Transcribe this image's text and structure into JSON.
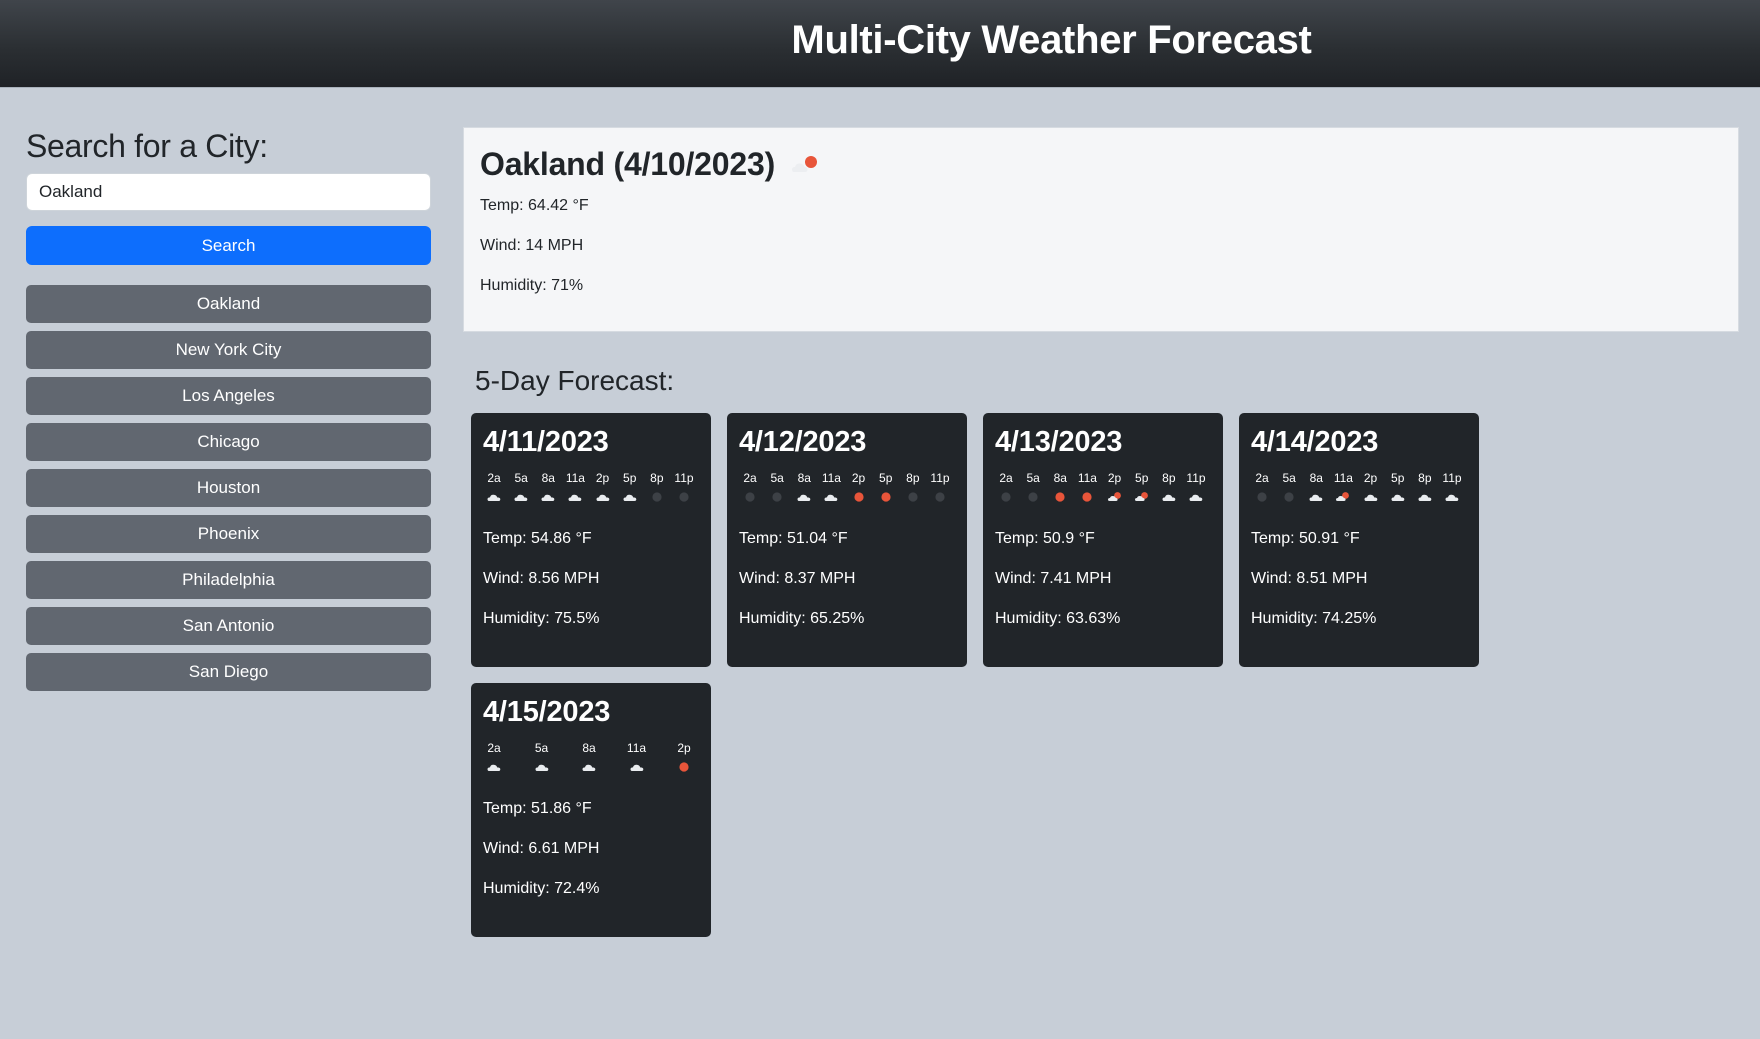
{
  "header": {
    "title": "Multi-City Weather Forecast"
  },
  "search": {
    "heading": "Search for a City:",
    "input_value": "Oakland",
    "button_label": "Search"
  },
  "history": [
    "Oakland",
    "New York City",
    "Los Angeles",
    "Chicago",
    "Houston",
    "Phoenix",
    "Philadelphia",
    "San Antonio",
    "San Diego"
  ],
  "current": {
    "title": "Oakland (4/10/2023)",
    "icon": "few-clouds-night-icon",
    "temp": "Temp: 64.42 °F",
    "wind": "Wind: 14 MPH",
    "humidity": "Humidity: 71%"
  },
  "forecast": {
    "heading": "5-Day Forecast:",
    "days": [
      {
        "date": "4/11/2023",
        "hours": [
          {
            "label": "2a",
            "icon": "cloud-icon"
          },
          {
            "label": "5a",
            "icon": "cloud-icon"
          },
          {
            "label": "8a",
            "icon": "cloud-icon"
          },
          {
            "label": "11a",
            "icon": "cloud-icon"
          },
          {
            "label": "2p",
            "icon": "cloud-icon"
          },
          {
            "label": "5p",
            "icon": "cloud-icon"
          },
          {
            "label": "8p",
            "icon": "clear-night-icon"
          },
          {
            "label": "11p",
            "icon": "clear-night-icon"
          }
        ],
        "temp": "Temp: 54.86 °F",
        "wind": "Wind: 8.56 MPH",
        "humidity": "Humidity: 75.5%"
      },
      {
        "date": "4/12/2023",
        "hours": [
          {
            "label": "2a",
            "icon": "clear-night-icon"
          },
          {
            "label": "5a",
            "icon": "clear-night-icon"
          },
          {
            "label": "8a",
            "icon": "cloud-icon"
          },
          {
            "label": "11a",
            "icon": "cloud-icon"
          },
          {
            "label": "2p",
            "icon": "sun-icon"
          },
          {
            "label": "5p",
            "icon": "sun-icon"
          },
          {
            "label": "8p",
            "icon": "clear-night-icon"
          },
          {
            "label": "11p",
            "icon": "clear-night-icon"
          }
        ],
        "temp": "Temp: 51.04 °F",
        "wind": "Wind: 8.37 MPH",
        "humidity": "Humidity: 65.25%"
      },
      {
        "date": "4/13/2023",
        "hours": [
          {
            "label": "2a",
            "icon": "clear-night-icon"
          },
          {
            "label": "5a",
            "icon": "clear-night-icon"
          },
          {
            "label": "8a",
            "icon": "sun-icon"
          },
          {
            "label": "11a",
            "icon": "sun-icon"
          },
          {
            "label": "2p",
            "icon": "partly-cloudy-icon"
          },
          {
            "label": "5p",
            "icon": "partly-cloudy-icon"
          },
          {
            "label": "8p",
            "icon": "cloud-icon"
          },
          {
            "label": "11p",
            "icon": "cloud-icon"
          }
        ],
        "temp": "Temp: 50.9 °F",
        "wind": "Wind: 7.41 MPH",
        "humidity": "Humidity: 63.63%"
      },
      {
        "date": "4/14/2023",
        "hours": [
          {
            "label": "2a",
            "icon": "clear-night-icon"
          },
          {
            "label": "5a",
            "icon": "clear-night-icon"
          },
          {
            "label": "8a",
            "icon": "cloud-icon"
          },
          {
            "label": "11a",
            "icon": "partly-cloudy-icon"
          },
          {
            "label": "2p",
            "icon": "cloud-icon"
          },
          {
            "label": "5p",
            "icon": "cloud-icon"
          },
          {
            "label": "8p",
            "icon": "cloud-icon"
          },
          {
            "label": "11p",
            "icon": "cloud-icon"
          }
        ],
        "temp": "Temp: 50.91 °F",
        "wind": "Wind: 8.51 MPH",
        "humidity": "Humidity: 74.25%"
      },
      {
        "date": "4/15/2023",
        "hours": [
          {
            "label": "2a",
            "icon": "cloud-icon"
          },
          {
            "label": "5a",
            "icon": "cloud-icon"
          },
          {
            "label": "8a",
            "icon": "cloud-icon"
          },
          {
            "label": "11a",
            "icon": "cloud-icon"
          },
          {
            "label": "2p",
            "icon": "sun-icon"
          }
        ],
        "temp": "Temp: 51.86 °F",
        "wind": "Wind: 6.61 MPH",
        "humidity": "Humidity: 72.4%"
      }
    ]
  },
  "colors": {
    "header_bg": "#2b2f33",
    "page_bg": "#c7ced7",
    "primary": "#0d6efd",
    "history_button": "#616770",
    "card_bg": "#212529",
    "sun": "#e8553a",
    "night_dot": "#3d4146",
    "cloud": "#e9ecef"
  }
}
